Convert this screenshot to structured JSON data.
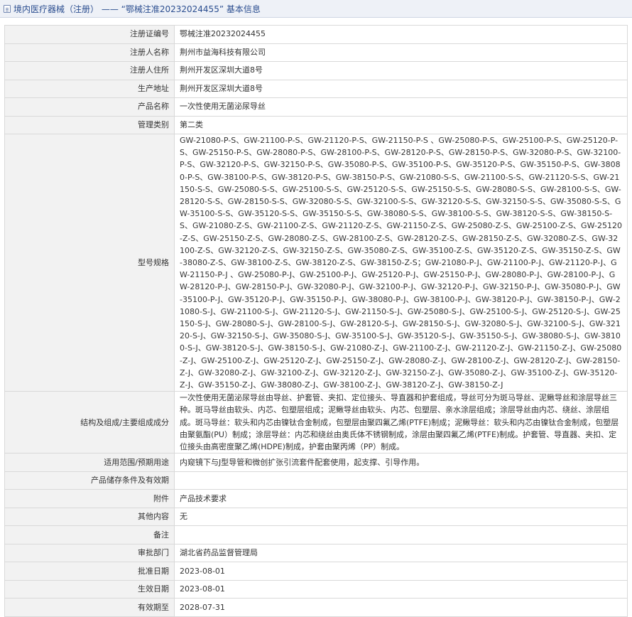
{
  "header": {
    "title": "境内医疗器械（注册） —— “鄂械注准20232024455” 基本信息"
  },
  "rows": [
    {
      "label": "注册证编号",
      "value": "鄂械注准20232024455"
    },
    {
      "label": "注册人名称",
      "value": "荆州市益海科技有限公司"
    },
    {
      "label": "注册人住所",
      "value": "荆州开发区深圳大道8号"
    },
    {
      "label": "生产地址",
      "value": "荆州开发区深圳大道8号"
    },
    {
      "label": "产品名称",
      "value": "一次性使用无菌泌尿导丝"
    },
    {
      "label": "管理类别",
      "value": "第二类"
    },
    {
      "label": "型号规格",
      "value": "GW-21080-P-S、GW-21100-P-S、GW-21120-P-S、GW-21150-P-S 、GW-25080-P-S、GW-25100-P-S、GW-25120-P-S、GW-25150-P-S、GW-28080-P-S、GW-28100-P-S、GW-28120-P-S、GW-28150-P-S、GW-32080-P-S、GW-32100-P-S、GW-32120-P-S、GW-32150-P-S、GW-35080-P-S、GW-35100-P-S、GW-35120-P-S、GW-35150-P-S、GW-38080-P-S、GW-38100-P-S、GW-38120-P-S、GW-38150-P-S、GW-21080-S-S、GW-21100-S-S、GW-21120-S-S、GW-21150-S-S、GW-25080-S-S、GW-25100-S-S、GW-25120-S-S、GW-25150-S-S、GW-28080-S-S、GW-28100-S-S、GW-28120-S-S、GW-28150-S-S、GW-32080-S-S、GW-32100-S-S、GW-32120-S-S、GW-32150-S-S、GW-35080-S-S、GW-35100-S-S、GW-35120-S-S、GW-35150-S-S、GW-38080-S-S、GW-38100-S-S、GW-38120-S-S、GW-38150-S-S、GW-21080-Z-S、GW-21100-Z-S、GW-21120-Z-S、GW-21150-Z-S、GW-25080-Z-S、GW-25100-Z-S、GW-25120-Z-S、GW-25150-Z-S、GW-28080-Z-S、GW-28100-Z-S、GW-28120-Z-S、GW-28150-Z-S、GW-32080-Z-S、GW-32100-Z-S、GW-32120-Z-S、GW-32150-Z-S、GW-35080-Z-S、GW-35100-Z-S、GW-35120-Z-S、GW-35150-Z-S、GW-38080-Z-S、GW-38100-Z-S、GW-38120-Z-S、GW-38150-Z-S；GW-21080-P-J、GW-21100-P-J、GW-21120-P-J、GW-21150-P-J 、GW-25080-P-J、GW-25100-P-J、GW-25120-P-J、GW-25150-P-J、GW-28080-P-J、GW-28100-P-J、GW-28120-P-J、GW-28150-P-J、GW-32080-P-J、GW-32100-P-J、GW-32120-P-J、GW-32150-P-J、GW-35080-P-J、GW-35100-P-J、GW-35120-P-J、GW-35150-P-J、GW-38080-P-J、GW-38100-P-J、GW-38120-P-J、GW-38150-P-J、GW-21080-S-J、GW-21100-S-J、GW-21120-S-J、GW-21150-S-J、GW-25080-S-J、GW-25100-S-J、GW-25120-S-J、GW-25150-S-J、GW-28080-S-J、GW-28100-S-J、GW-28120-S-J、GW-28150-S-J、GW-32080-S-J、GW-32100-S-J、GW-32120-S-J、GW-32150-S-J、GW-35080-S-J、GW-35100-S-J、GW-35120-S-J、GW-35150-S-J、GW-38080-S-J、GW-38100-S-J、GW-38120-S-J、GW-38150-S-J、GW-21080-Z-J、GW-21100-Z-J、GW-21120-Z-J、GW-21150-Z-J、GW-25080-Z-J、GW-25100-Z-J、GW-25120-Z-J、GW-25150-Z-J、GW-28080-Z-J、GW-28100-Z-J、GW-28120-Z-J、GW-28150-Z-J、GW-32080-Z-J、GW-32100-Z-J、GW-32120-Z-J、GW-32150-Z-J、GW-35080-Z-J、GW-35100-Z-J、GW-35120-Z-J、GW-35150-Z-J、GW-38080-Z-J、GW-38100-Z-J、GW-38120-Z-J、GW-38150-Z-J"
    },
    {
      "label": "结构及组成/主要组成成分",
      "value": "一次性使用无菌泌尿导丝由导丝、护套管、夹扣、定位接头、导直器和护套组成，导丝可分为斑马导丝、泥鳅导丝和涂层导丝三种。斑马导丝由软头、内芯、包塑层组成；泥鳅导丝由软头、内芯、包塑层、亲水涂层组成；涂层导丝由内芯、绕丝、涂层组成。斑马导丝：软头和内芯由镍钛合金制成，包塑层由聚四氟乙烯(PTFE)制成；泥鳅导丝：软头和内芯由镍钛合金制成，包塑层由聚氨酯(PU）制成；涂层导丝：内芯和绕丝由奥氏体不锈钢制成，涂层由聚四氟乙烯(PTFE)制成。护套管、导直器、夹扣、定位接头由高密度聚乙烯(HDPE)制成，护套由聚丙烯（PP）制成。"
    },
    {
      "label": "适用范围/预期用途",
      "value": "内窥镜下与J型导管和微创扩张引流套件配套使用，起支撑、引导作用。"
    },
    {
      "label": "产品储存条件及有效期",
      "value": ""
    },
    {
      "label": "附件",
      "value": "产品技术要求"
    },
    {
      "label": "其他内容",
      "value": "无"
    },
    {
      "label": "备注",
      "value": ""
    },
    {
      "label": "审批部门",
      "value": "湖北省药品监督管理局"
    },
    {
      "label": "批准日期",
      "value": "2023-08-01"
    },
    {
      "label": "生效日期",
      "value": "2023-08-01"
    },
    {
      "label": "有效期至",
      "value": "2028-07-31"
    }
  ]
}
